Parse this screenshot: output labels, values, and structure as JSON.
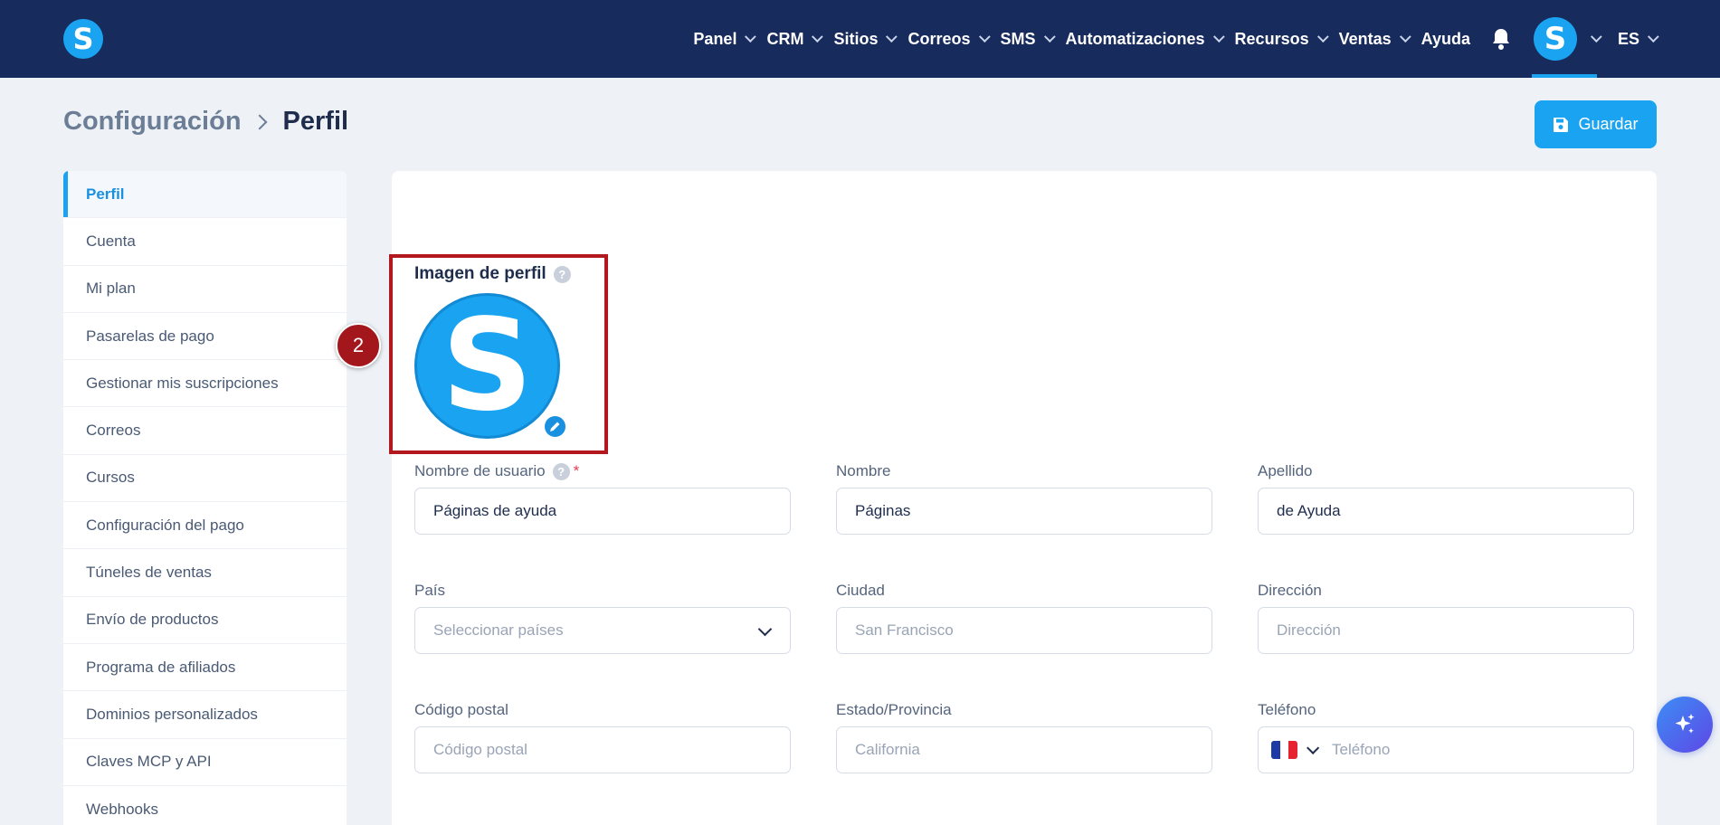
{
  "nav": {
    "logo_letter": "S",
    "items": [
      {
        "label": "Panel",
        "has_menu": true
      },
      {
        "label": "CRM",
        "has_menu": true
      },
      {
        "label": "Sitios",
        "has_menu": true
      },
      {
        "label": "Correos",
        "has_menu": true
      },
      {
        "label": "SMS",
        "has_menu": true
      },
      {
        "label": "Automatizaciones",
        "has_menu": true
      },
      {
        "label": "Recursos",
        "has_menu": true
      },
      {
        "label": "Ventas",
        "has_menu": true
      },
      {
        "label": "Ayuda",
        "has_menu": false
      }
    ],
    "avatar_letter": "S",
    "language": "ES"
  },
  "header": {
    "breadcrumb_parent": "Configuración",
    "breadcrumb_current": "Perfil",
    "save_label": "Guardar"
  },
  "sidebar": {
    "items": [
      {
        "label": "Perfil",
        "active": true
      },
      {
        "label": "Cuenta"
      },
      {
        "label": "Mi plan"
      },
      {
        "label": "Pasarelas de pago"
      },
      {
        "label": "Gestionar mis suscripciones"
      },
      {
        "label": "Correos"
      },
      {
        "label": "Cursos"
      },
      {
        "label": "Configuración del pago"
      },
      {
        "label": "Túneles de ventas"
      },
      {
        "label": "Envío de productos"
      },
      {
        "label": "Programa de afiliados"
      },
      {
        "label": "Dominios personalizados"
      },
      {
        "label": "Claves MCP y API"
      },
      {
        "label": "Webhooks"
      }
    ]
  },
  "profile": {
    "picture_label": "Imagen de perfil",
    "picture_letter": "S",
    "step_number": "2",
    "help_glyph": "?",
    "required_mark": "*",
    "fields": {
      "username": {
        "label": "Nombre de usuario",
        "value": "Páginas de ayuda"
      },
      "first_name": {
        "label": "Nombre",
        "value": "Páginas"
      },
      "last_name": {
        "label": "Apellido",
        "value": "de Ayuda"
      },
      "country": {
        "label": "País",
        "placeholder": "Seleccionar países"
      },
      "city": {
        "label": "Ciudad",
        "placeholder": "San Francisco"
      },
      "address": {
        "label": "Dirección",
        "placeholder": "Dirección"
      },
      "postal_code": {
        "label": "Código postal",
        "placeholder": "Código postal"
      },
      "state": {
        "label": "Estado/Provincia",
        "placeholder": "California"
      },
      "phone": {
        "label": "Teléfono",
        "placeholder": "Teléfono",
        "flag_colors": [
          "#1d3aa5",
          "#ffffff",
          "#e6222f"
        ]
      }
    }
  },
  "colors": {
    "topbar": "#172b5c",
    "accent": "#1aa3f0",
    "highlight": "#b3181f"
  }
}
